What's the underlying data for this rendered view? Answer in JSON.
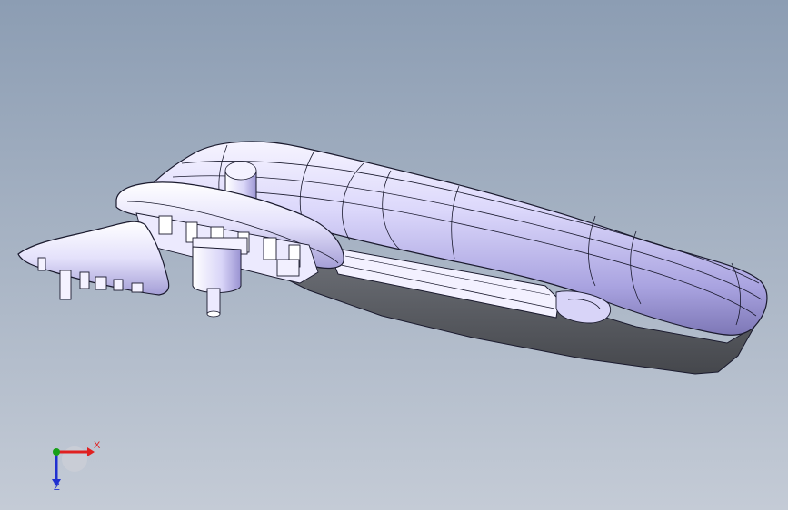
{
  "viewport": {
    "background_top": "#8c9db3",
    "background_bottom": "#c4cbd6",
    "model_shading": [
      "#f4f2ff",
      "#cfcaf5",
      "#8a84c4"
    ],
    "edge_color": "#1a1a2e",
    "underside_color": "#55585f"
  },
  "triad": {
    "x_label": "X",
    "z_label": "Z",
    "x_color": "#e02020",
    "y_color": "#18a018",
    "z_color": "#2030d0"
  }
}
